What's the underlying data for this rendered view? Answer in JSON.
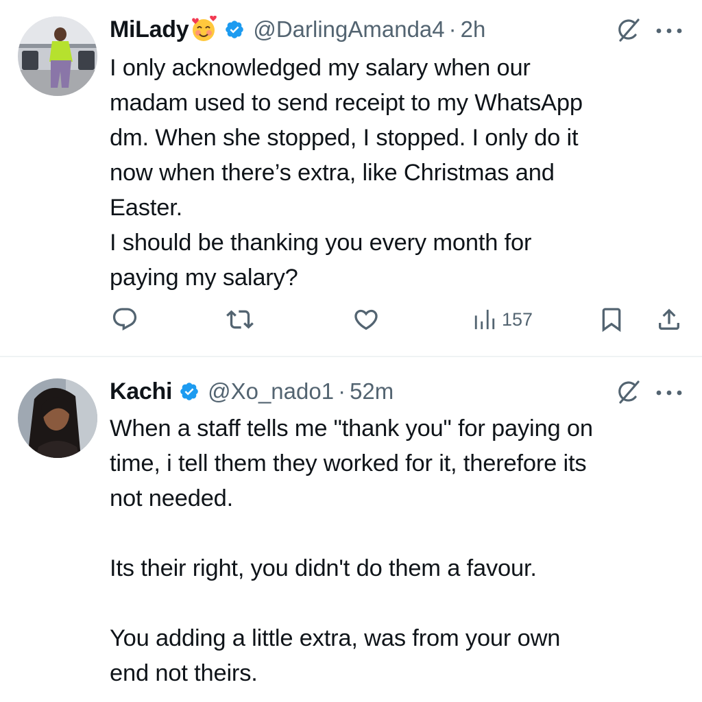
{
  "tweets": [
    {
      "display_name": "MiLady",
      "name_emoji": "smiling-face-with-hearts",
      "handle": "@DarlingAmanda4",
      "separator": "·",
      "time": "2h",
      "lines": [
        "I only acknowledged my salary when our",
        "madam used to send receipt to my WhatsApp",
        "dm. When she stopped, I stopped. I only do it",
        "now when there’s extra, like Christmas and",
        "Easter.",
        "I should be thanking you every month for",
        "paying my salary?"
      ],
      "views": "157"
    },
    {
      "display_name": "Kachi",
      "handle": "@Xo_nado1",
      "separator": "·",
      "time": "52m",
      "lines": [
        "When a staff tells me \"thank you\" for paying on",
        "time, i tell them they worked for it, therefore its",
        "not needed.",
        "",
        "Its their right, you didn't do them a favour.",
        "",
        "You adding a little extra, was from your own",
        "end not theirs."
      ]
    }
  ],
  "colors": {
    "text": "#0f1419",
    "secondary": "#536471",
    "verified": "#1d9bf0",
    "divider": "#eff3f4"
  },
  "icons": [
    "verified-badge-icon",
    "grok-icon",
    "more-icon",
    "reply-icon",
    "repost-icon",
    "like-icon",
    "views-icon",
    "bookmark-icon",
    "share-icon"
  ]
}
